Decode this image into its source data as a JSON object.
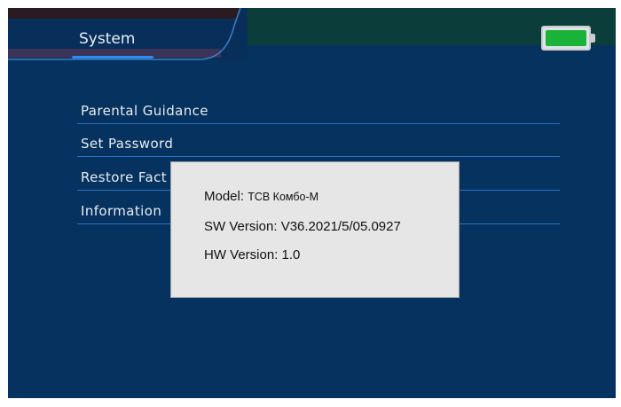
{
  "header": {
    "title": "System",
    "battery_icon": "battery-full-icon",
    "battery_color": "#1bb23a"
  },
  "menu": {
    "items": [
      {
        "label": "Parental Guidance"
      },
      {
        "label": "Set Password"
      },
      {
        "label": "Restore Fact"
      },
      {
        "label": "Information"
      }
    ]
  },
  "dialog": {
    "model_label": "Model:",
    "model_value": "ТСВ Комбо-М",
    "sw_label": "SW Version:",
    "sw_value": "V36.2021/5/05.0927",
    "hw_label": "HW Version:",
    "hw_value": "1.0"
  }
}
